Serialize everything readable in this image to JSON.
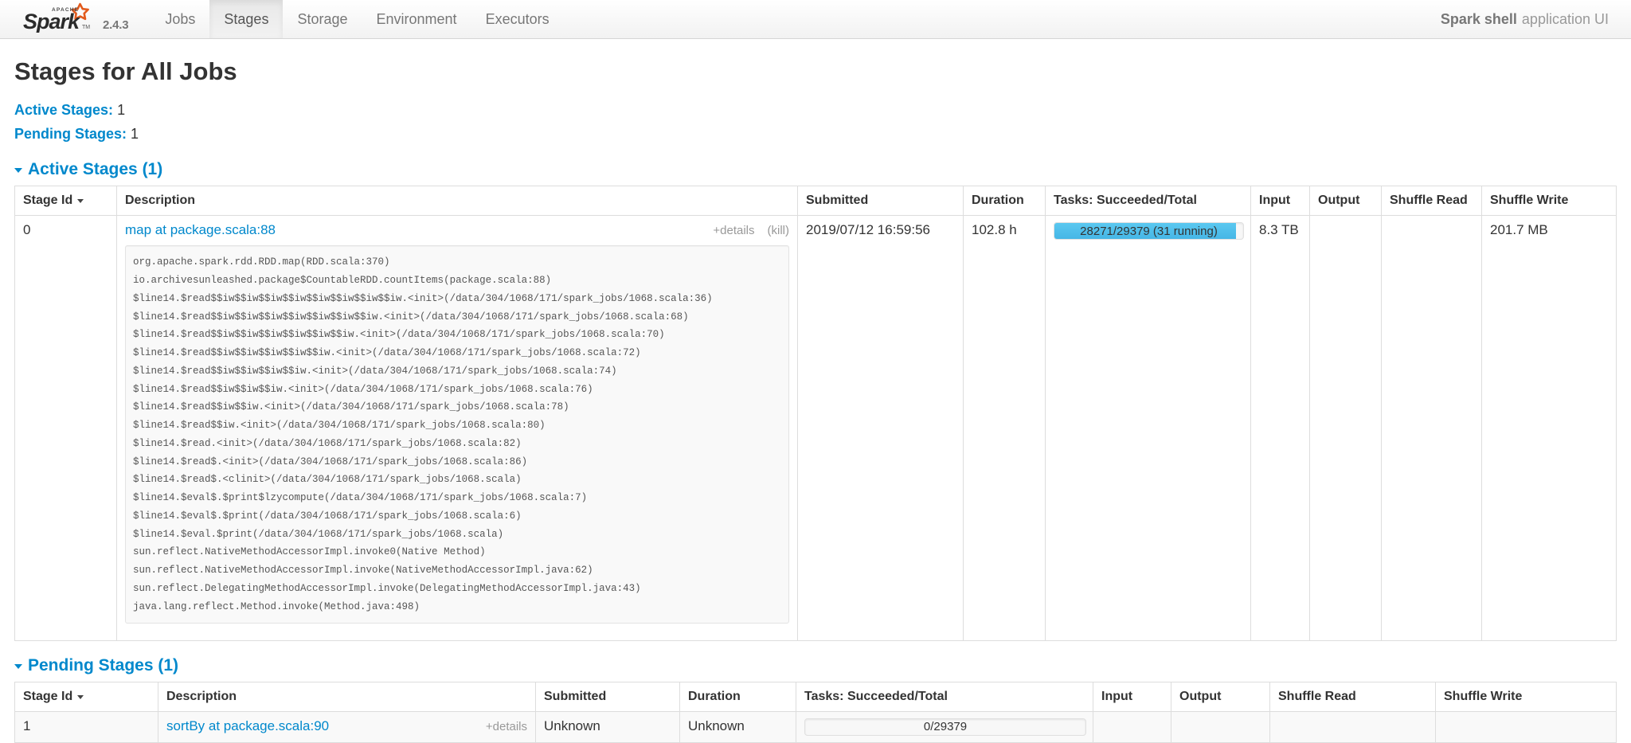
{
  "navbar": {
    "brand": {
      "logo_alt": "Apache Spark",
      "logo_wordmark": "Spark",
      "logo_supertext": "APACHE",
      "version": "2.4.3"
    },
    "items": [
      {
        "label": "Jobs",
        "active": false
      },
      {
        "label": "Stages",
        "active": true
      },
      {
        "label": "Storage",
        "active": false
      },
      {
        "label": "Environment",
        "active": false
      },
      {
        "label": "Executors",
        "active": false
      }
    ],
    "app_name": "Spark shell",
    "app_suffix": "application UI"
  },
  "page": {
    "title": "Stages for All Jobs",
    "summary": [
      {
        "label": "Active Stages:",
        "value": "1"
      },
      {
        "label": "Pending Stages:",
        "value": "1"
      }
    ]
  },
  "active_stages": {
    "section_title": "Active Stages (1)",
    "columns": [
      "Stage Id",
      "Description",
      "Submitted",
      "Duration",
      "Tasks: Succeeded/Total",
      "Input",
      "Output",
      "Shuffle Read",
      "Shuffle Write"
    ],
    "rows": [
      {
        "stage_id": "0",
        "description_link": "map at package.scala:88",
        "details_toggle": "+details",
        "kill_link": "(kill)",
        "submitted": "2019/07/12 16:59:56",
        "duration": "102.8 h",
        "tasks_label": "28271/29379 (31 running)",
        "tasks_succeeded": 28271,
        "tasks_total": 29379,
        "tasks_running": 31,
        "input": "8.3 TB",
        "output": "",
        "shuffle_read": "",
        "shuffle_write": "201.7 MB",
        "stacktrace": "org.apache.spark.rdd.RDD.map(RDD.scala:370)\nio.archivesunleashed.package$CountableRDD.countItems(package.scala:88)\n$line14.$read$$iw$$iw$$iw$$iw$$iw$$iw$$iw$$iw.<init>(/data/304/1068/171/spark_jobs/1068.scala:36)\n$line14.$read$$iw$$iw$$iw$$iw$$iw$$iw$$iw.<init>(/data/304/1068/171/spark_jobs/1068.scala:68)\n$line14.$read$$iw$$iw$$iw$$iw$$iw$$iw.<init>(/data/304/1068/171/spark_jobs/1068.scala:70)\n$line14.$read$$iw$$iw$$iw$$iw$$iw.<init>(/data/304/1068/171/spark_jobs/1068.scala:72)\n$line14.$read$$iw$$iw$$iw$$iw.<init>(/data/304/1068/171/spark_jobs/1068.scala:74)\n$line14.$read$$iw$$iw$$iw.<init>(/data/304/1068/171/spark_jobs/1068.scala:76)\n$line14.$read$$iw$$iw.<init>(/data/304/1068/171/spark_jobs/1068.scala:78)\n$line14.$read$$iw.<init>(/data/304/1068/171/spark_jobs/1068.scala:80)\n$line14.$read.<init>(/data/304/1068/171/spark_jobs/1068.scala:82)\n$line14.$read$.<init>(/data/304/1068/171/spark_jobs/1068.scala:86)\n$line14.$read$.<clinit>(/data/304/1068/171/spark_jobs/1068.scala)\n$line14.$eval$.$print$lzycompute(/data/304/1068/171/spark_jobs/1068.scala:7)\n$line14.$eval$.$print(/data/304/1068/171/spark_jobs/1068.scala:6)\n$line14.$eval.$print(/data/304/1068/171/spark_jobs/1068.scala)\nsun.reflect.NativeMethodAccessorImpl.invoke0(Native Method)\nsun.reflect.NativeMethodAccessorImpl.invoke(NativeMethodAccessorImpl.java:62)\nsun.reflect.DelegatingMethodAccessorImpl.invoke(DelegatingMethodAccessorImpl.java:43)\njava.lang.reflect.Method.invoke(Method.java:498)"
      }
    ]
  },
  "pending_stages": {
    "section_title": "Pending Stages (1)",
    "columns": [
      "Stage Id",
      "Description",
      "Submitted",
      "Duration",
      "Tasks: Succeeded/Total",
      "Input",
      "Output",
      "Shuffle Read",
      "Shuffle Write"
    ],
    "rows": [
      {
        "stage_id": "1",
        "description_link": "sortBy at package.scala:90",
        "details_toggle": "+details",
        "submitted": "Unknown",
        "duration": "Unknown",
        "tasks_label": "0/29379",
        "tasks_succeeded": 0,
        "tasks_total": 29379,
        "tasks_running": 0,
        "input": "",
        "output": "",
        "shuffle_read": "",
        "shuffle_write": ""
      }
    ]
  },
  "colors": {
    "link": "#0088cc",
    "progress_fill": "#45b6e6",
    "logo_orange": "#e25a1c",
    "text": "#333333",
    "muted": "#999999",
    "border": "#dddddd"
  }
}
